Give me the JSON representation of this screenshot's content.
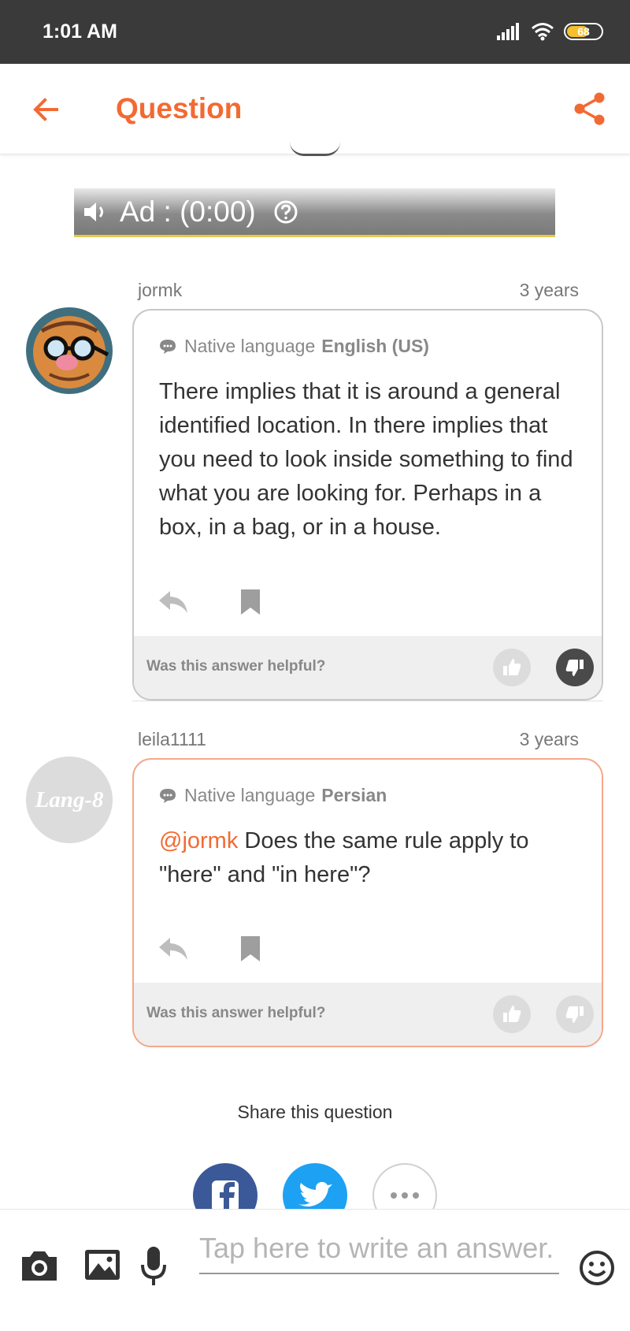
{
  "status_bar": {
    "time": "1:01 AM",
    "battery": "68",
    "battery_fraction": 0.68
  },
  "app_bar": {
    "title": "Question",
    "back_icon": "back-arrow-icon",
    "share_icon": "share-icon"
  },
  "ad": {
    "label": "Ad : (0:00)"
  },
  "answers": [
    {
      "username": "jormk",
      "time_ago": "3 years",
      "native_label": "Native language",
      "native_value": "English (US)",
      "text": "There implies that it is around a general identified location. In there implies that you need to look inside something to find what you are looking for. Perhaps in a box, in a bag, or in a house.",
      "helpful_label": "Was this answer helpful?"
    },
    {
      "username": "leila1111",
      "time_ago": "3 years",
      "avatar_text": "Lang-8",
      "native_label": "Native language",
      "native_value": "Persian",
      "mention": "@jormk",
      "text": " Does the same rule apply to \"here\" and \"in here\"?",
      "helpful_label": "Was this answer helpful?"
    }
  ],
  "share": {
    "label": "Share this question"
  },
  "composer": {
    "placeholder": "Tap here to write an answer."
  },
  "colors": {
    "accent": "#f26a33",
    "status_bar": "#3a3a3a",
    "facebook": "#3b5998",
    "twitter": "#1da1f2"
  }
}
